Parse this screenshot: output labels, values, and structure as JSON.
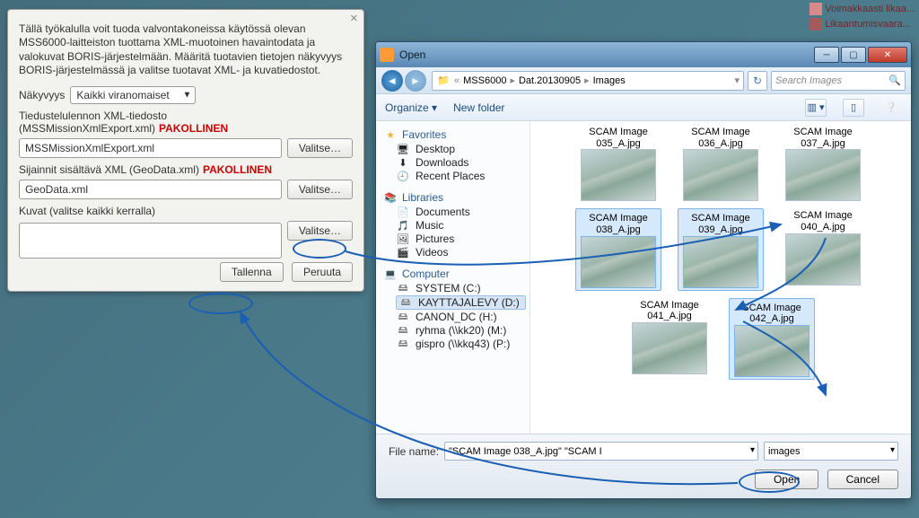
{
  "map_legend": {
    "row1": "Voimakkaasti likaa...",
    "row2": "Likaantumisvaara..."
  },
  "import": {
    "desc": "Tällä työkalulla voit tuoda valvontakoneissa käytössä olevan MSS6000-laitteiston tuottama XML-muotoinen havaintodata ja valokuvat BORIS-järjestelmään. Määritä tuotavien tietojen näkyvyys BORIS-järjestelmässä ja valitse tuotavat XML- ja kuvatiedostot.",
    "visibility_label": "Näkyvyys",
    "visibility_value": "Kaikki viranomaiset",
    "xml_label": "Tiedustelulennon XML-tiedosto (MSSMissionXmlExport.xml)",
    "required_text": "PAKOLLINEN",
    "xml_value": "MSSMissionXmlExport.xml",
    "geo_label": "Sijainnit sisältävä XML (GeoData.xml)",
    "geo_value": "GeoData.xml",
    "images_label": "Kuvat (valitse kaikki kerralla)",
    "browse": "Valitse…",
    "save": "Tallenna",
    "cancel": "Peruuta"
  },
  "open": {
    "title": "Open",
    "breadcrumb": {
      "seg1": "MSS6000",
      "seg2": "Dat.20130905",
      "seg3": "Images"
    },
    "search_placeholder": "Search Images",
    "organize": "Organize",
    "newfolder": "New folder",
    "sidebar": {
      "favorites": "Favorites",
      "desktop": "Desktop",
      "downloads": "Downloads",
      "recent": "Recent Places",
      "libraries": "Libraries",
      "documents": "Documents",
      "music": "Music",
      "pictures": "Pictures",
      "videos": "Videos",
      "computer": "Computer",
      "drives": [
        "SYSTEM (C:)",
        "KAYTTAJALEVY (D:)",
        "CANON_DC (H:)",
        "ryhma (\\\\kk20) (M:)",
        "gispro (\\\\kkq43) (P:)"
      ]
    },
    "files": [
      {
        "name": "SCAM Image 035_A.jpg",
        "sel": false
      },
      {
        "name": "SCAM Image 036_A.jpg",
        "sel": false
      },
      {
        "name": "SCAM Image 037_A.jpg",
        "sel": false
      },
      {
        "name": "SCAM Image 038_A.jpg",
        "sel": true
      },
      {
        "name": "SCAM Image 039_A.jpg",
        "sel": true
      },
      {
        "name": "SCAM Image 040_A.jpg",
        "sel": false
      },
      {
        "name": "SCAM Image 041_A.jpg",
        "sel": false
      },
      {
        "name": "SCAM Image 042_A.jpg",
        "sel": true
      }
    ],
    "filename_label": "File name:",
    "filename_value": "\"SCAM Image 038_A.jpg\" \"SCAM I",
    "filter_value": "images",
    "open_btn": "Open",
    "cancel_btn": "Cancel"
  }
}
